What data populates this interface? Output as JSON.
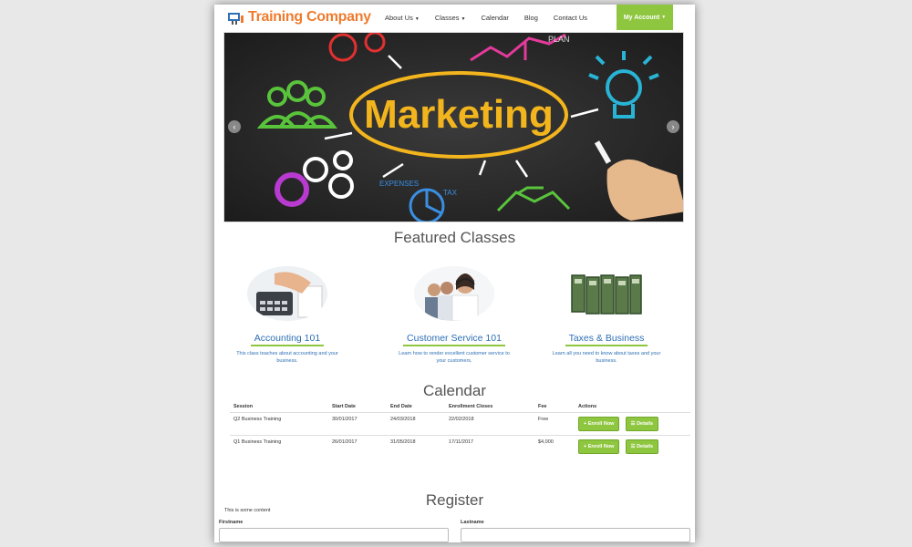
{
  "brand": {
    "name": "Training Company",
    "accent": "#ef7b2e",
    "green": "#8ec63f",
    "link": "#2e6fb5"
  },
  "nav": {
    "items": [
      {
        "label": "About Us",
        "dropdown": true
      },
      {
        "label": "Classes",
        "dropdown": true
      },
      {
        "label": "Calendar",
        "dropdown": false
      },
      {
        "label": "Blog",
        "dropdown": false
      },
      {
        "label": "Contact Us",
        "dropdown": false
      }
    ],
    "account": "My Account"
  },
  "slider": {
    "main_word": "Marketing",
    "labels": [
      "EXPENSES",
      "TAX",
      "PLAN"
    ],
    "prev_icon": "chevron-left-icon",
    "next_icon": "chevron-right-icon"
  },
  "featured": {
    "title": "Featured Classes",
    "courses": [
      {
        "title": "Accounting 101",
        "desc": "This class teaches about accounting and your business."
      },
      {
        "title": "Customer Service 101",
        "desc": "Learn how to render excellent customer service to your customers."
      },
      {
        "title": "Taxes & Business",
        "desc": "Learn all you need to know about taxes and your business."
      }
    ]
  },
  "calendar": {
    "title": "Calendar",
    "columns": [
      "Session",
      "Start Date",
      "End Date",
      "Enrollment Closes",
      "Fee",
      "Actions"
    ],
    "rows": [
      {
        "session": "Q2 Business Training",
        "start": "30/01/2017",
        "end": "24/03/2018",
        "closes": "22/02/2018",
        "fee": "Free"
      },
      {
        "session": "Q1 Business Training",
        "start": "26/01/2017",
        "end": "31/05/2018",
        "closes": "17/11/2017",
        "fee": "$4,000"
      }
    ],
    "enroll_label": "+ Enroll Now",
    "details_label": "Details"
  },
  "register": {
    "title": "Register",
    "content": "This is some content",
    "firstname_label": "Firstname",
    "lastname_label": "Lastname"
  }
}
